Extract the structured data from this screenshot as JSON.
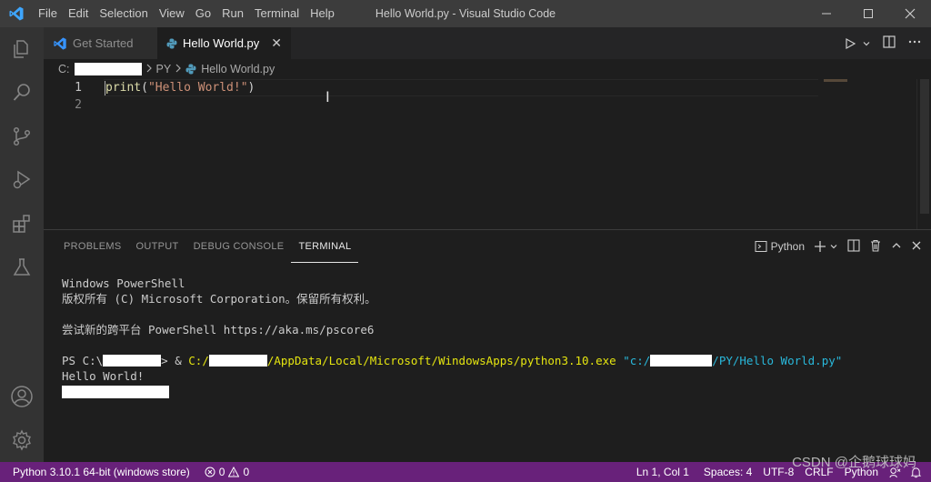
{
  "window": {
    "title": "Hello World.py - Visual Studio Code",
    "menu": [
      "File",
      "Edit",
      "Selection",
      "View",
      "Go",
      "Run",
      "Terminal",
      "Help"
    ],
    "controls": {
      "minimize": "─",
      "maximize": "☐",
      "close": "✕"
    }
  },
  "activity_bar": [
    "explorer-icon",
    "search-icon",
    "source-control-icon",
    "run-debug-icon",
    "extensions-icon",
    "testing-icon",
    "account-icon",
    "settings-gear-icon"
  ],
  "tabs": [
    {
      "label": "Get Started",
      "icon": "vscode-logo-icon",
      "active": false
    },
    {
      "label": "Hello World.py",
      "icon": "python-icon",
      "active": true,
      "close": "✕"
    }
  ],
  "breadcrumbs": {
    "drive": "C:",
    "folder": "PY",
    "file": "Hello World.py"
  },
  "editor": {
    "lines": [
      {
        "number": "1",
        "fn": "print",
        "open": "(",
        "str": "\"Hello World!\"",
        "close": ")"
      },
      {
        "number": "2"
      }
    ]
  },
  "panel": {
    "tabs": [
      "PROBLEMS",
      "OUTPUT",
      "DEBUG CONSOLE",
      "TERMINAL"
    ],
    "active_tab": "TERMINAL",
    "terminal_name": "Python",
    "terminal": {
      "line1": "Windows PowerShell",
      "line2": "版权所有 (C) Microsoft Corporation。保留所有权利。",
      "line3": "尝试新的跨平台 PowerShell https://aka.ms/pscore6",
      "prompt_prefix": "PS C:\\",
      "prompt_gt": "> & ",
      "exe_drive": "C:/",
      "exe_rest": "/AppData/Local/Microsoft/WindowsApps/python3.10.exe",
      "arg_prefix": "\"c:/",
      "arg_rest": "/PY/Hello World.py\"",
      "output": "Hello World!"
    }
  },
  "status_bar": {
    "interpreter": "Python 3.10.1 64-bit (windows store)",
    "errors": "0",
    "warnings": "0",
    "position": "Ln 1, Col 1",
    "spaces": "Spaces: 4",
    "encoding": "UTF-8",
    "eol": "CRLF",
    "language": "Python"
  },
  "watermark": "CSDN @企鹅球球妈",
  "colors": {
    "status_bar": "#68217a",
    "accent_blue": "#3794ff",
    "title_bar": "#3c3c3c"
  }
}
